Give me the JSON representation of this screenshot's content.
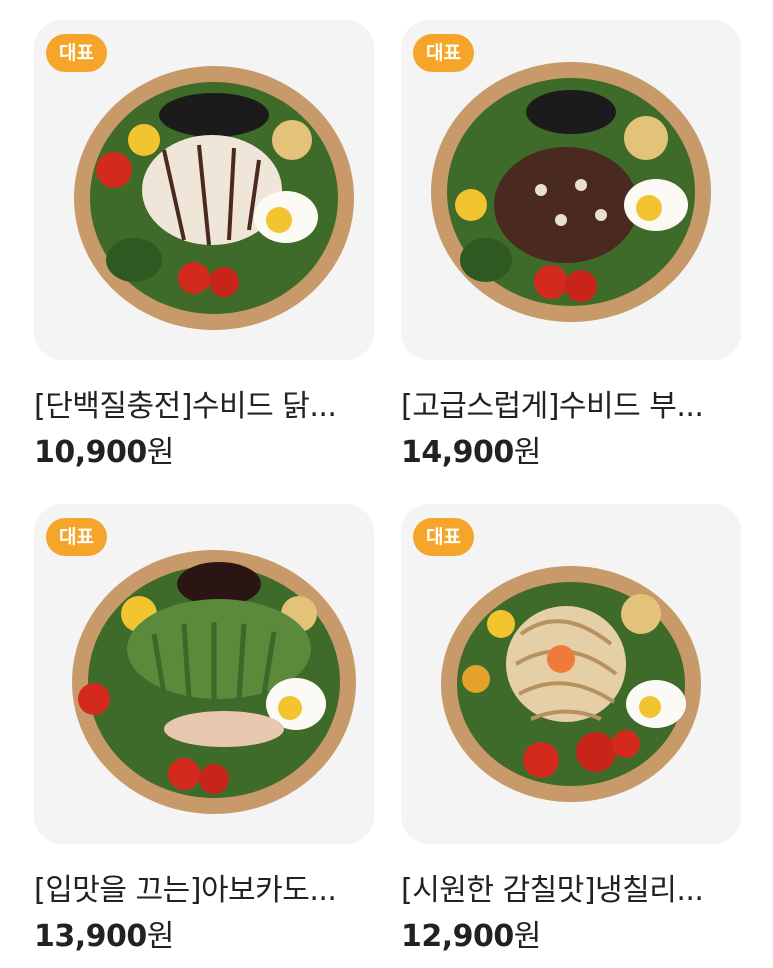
{
  "products": [
    {
      "badge": "대표",
      "name": "[단백질충전]수비드 닭...",
      "price": "10,900",
      "unit": "원",
      "image": "salad-chicken-image"
    },
    {
      "badge": "대표",
      "name": "[고급스럽게]수비드 부...",
      "price": "14,900",
      "unit": "원",
      "image": "salad-beef-image"
    },
    {
      "badge": "대표",
      "name": "[입맛을 끄는]아보카도...",
      "price": "13,900",
      "unit": "원",
      "image": "salad-avocado-image"
    },
    {
      "badge": "대표",
      "name": "[시원한 감칠맛]냉칠리...",
      "price": "12,900",
      "unit": "원",
      "image": "salad-noodle-image"
    }
  ]
}
